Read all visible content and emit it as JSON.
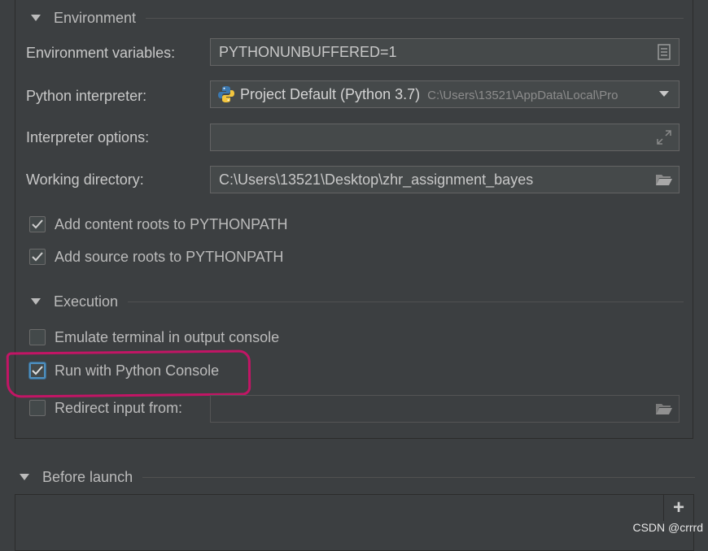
{
  "environment": {
    "title": "Environment",
    "env_vars_label": "Environment variables:",
    "env_vars_value": "PYTHONUNBUFFERED=1",
    "interpreter_label": "Python interpreter:",
    "interpreter_value": "Project Default (Python 3.7)",
    "interpreter_path": "C:\\Users\\13521\\AppData\\Local\\Pro",
    "interp_options_label": "Interpreter options:",
    "interp_options_value": "",
    "workdir_label": "Working directory:",
    "workdir_value": "C:\\Users\\13521\\Desktop\\zhr_assignment_bayes",
    "content_roots_label": "Add content roots to PYTHONPATH",
    "content_roots_checked": true,
    "source_roots_label": "Add source roots to PYTHONPATH",
    "source_roots_checked": true
  },
  "execution": {
    "title": "Execution",
    "emulate_terminal_label": "Emulate terminal in output console",
    "emulate_terminal_checked": false,
    "python_console_label": "Run with Python Console",
    "python_console_checked": true,
    "redirect_label": "Redirect input from:",
    "redirect_checked": false,
    "redirect_value": ""
  },
  "before_launch": {
    "title": "Before launch",
    "add_label": "+"
  },
  "watermark": "CSDN @crrrd",
  "colors": {
    "highlight": "#c21565",
    "focus": "#4e8fbe",
    "background": "#3c3f41"
  }
}
